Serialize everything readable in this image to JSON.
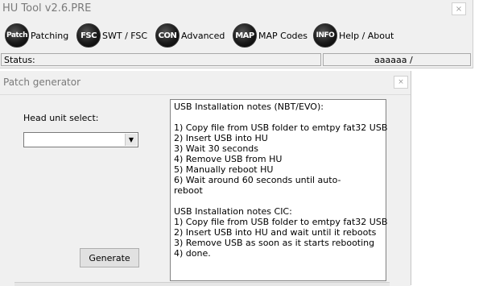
{
  "main_window": {
    "title": "HU Tool v2.6.PRE",
    "close": "×"
  },
  "toolbar": [
    {
      "icon_text": "Patch",
      "label": "Patching",
      "icon": "patch-icon"
    },
    {
      "icon_text": "FSC",
      "label": "SWT / FSC",
      "icon": "fsc-icon"
    },
    {
      "icon_text": "CON",
      "label": "Advanced",
      "icon": "con-icon"
    },
    {
      "icon_text": "MAP",
      "label": "MAP Codes",
      "icon": "map-icon"
    },
    {
      "icon_text": "INFO",
      "label": "Help / About",
      "icon": "info-icon"
    }
  ],
  "status": {
    "label": "Status:",
    "value": "aaaaaa /"
  },
  "dialog": {
    "title": "Patch generator",
    "close": "×",
    "head_unit_label": "Head unit select:",
    "head_unit_value": "",
    "generate_label": "Generate",
    "notes": [
      "USB Installation notes (NBT/EVO):",
      "",
      "1) Copy file from USB folder to emtpy fat32 USB",
      "2) Insert USB into HU",
      "3) Wait 30 seconds",
      "4) Remove USB from HU",
      "5) Manually reboot HU",
      "6) Wait around 60 seconds until auto-",
      "reboot",
      "",
      "USB Installation notes CIC:",
      "1) Copy file from USB folder to emtpy fat32 USB",
      "2) Insert USB into HU and wait until it reboots",
      "3) Remove USB as soon as it starts rebooting",
      "4) done."
    ]
  }
}
